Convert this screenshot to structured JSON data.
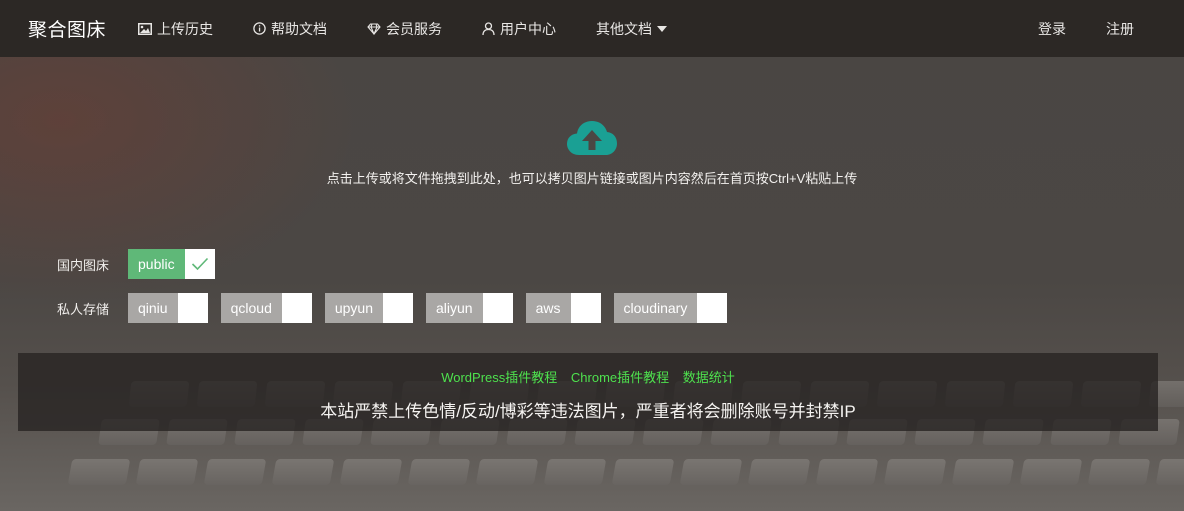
{
  "nav": {
    "brand": "聚合图床",
    "items": [
      {
        "label": "上传历史",
        "icon": "image-icon"
      },
      {
        "label": "帮助文档",
        "icon": "info-circle-icon"
      },
      {
        "label": "会员服务",
        "icon": "diamond-icon"
      },
      {
        "label": "用户中心",
        "icon": "user-icon"
      },
      {
        "label": "其他文档",
        "icon": "caret-down-icon"
      }
    ],
    "login": "登录",
    "register": "注册"
  },
  "upload": {
    "icon": "cloud-upload-icon",
    "hint": "点击上传或将文件拖拽到此处，也可以拷贝图片链接或图片内容然后在首页按Ctrl+V粘贴上传",
    "icon_color": "#1aa094"
  },
  "storage": {
    "domestic_label": "国内图床",
    "domestic_options": [
      {
        "name": "public",
        "checked": true
      }
    ],
    "private_label": "私人存储",
    "private_options": [
      {
        "name": "qiniu",
        "checked": false
      },
      {
        "name": "qcloud",
        "checked": false
      },
      {
        "name": "upyun",
        "checked": false
      },
      {
        "name": "aliyun",
        "checked": false
      },
      {
        "name": "aws",
        "checked": false
      },
      {
        "name": "cloudinary",
        "checked": false
      }
    ],
    "active_color": "#5fb878"
  },
  "footer": {
    "links": [
      "WordPress插件教程",
      "Chrome插件教程",
      "数据统计"
    ],
    "notice": "本站严禁上传色情/反动/博彩等违法图片，严重者将会删除账号并封禁IP",
    "link_color": "#4ee14e"
  }
}
